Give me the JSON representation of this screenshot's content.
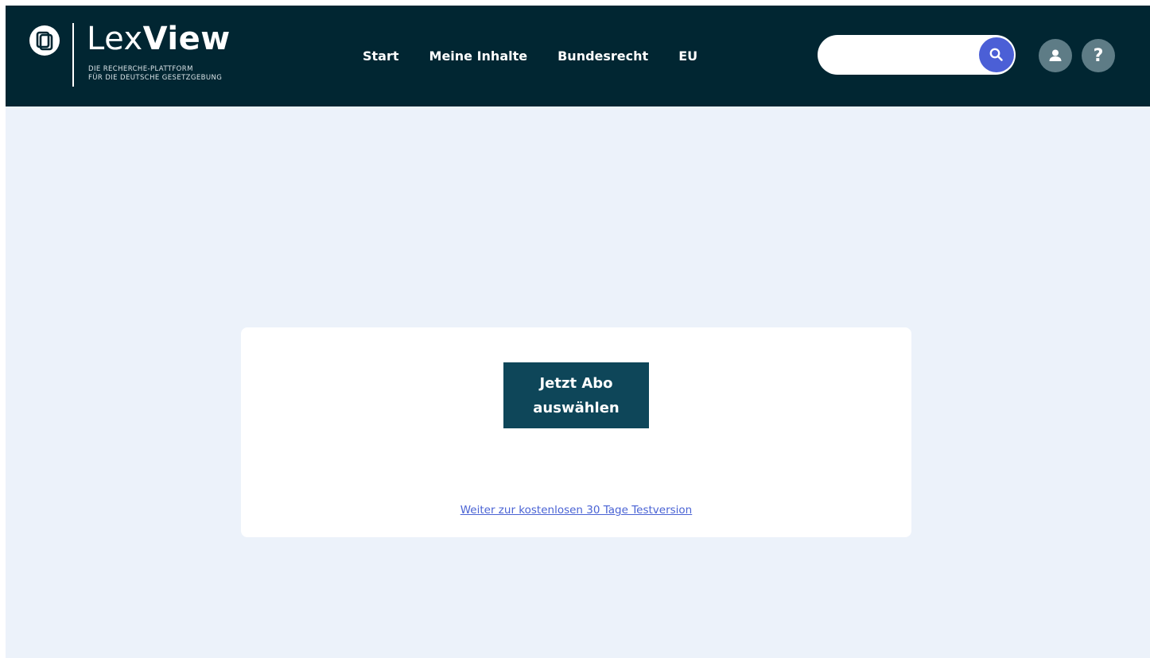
{
  "brand": {
    "name_light": "Lex",
    "name_bold": "View",
    "tagline_line1": "DIE RECHERCHE-PLATTFORM",
    "tagline_line2": "FÜR DIE DEUTSCHE GESETZGEBUNG"
  },
  "nav": {
    "items": [
      {
        "label": "Start"
      },
      {
        "label": "Meine Inhalte"
      },
      {
        "label": "Bundesrecht"
      },
      {
        "label": "EU"
      }
    ]
  },
  "search": {
    "value": "",
    "placeholder": ""
  },
  "header_buttons": {
    "help_glyph": "?"
  },
  "main": {
    "cta_label": "Jetzt Abo auswählen",
    "trial_link": "Weiter zur kostenlosen 30 Tage Testversion"
  },
  "colors": {
    "header_bg": "#012632",
    "page_bg": "#ecf2fa",
    "search_accent": "#4b5fd6",
    "cta_bg": "#0e4659",
    "link": "#4a63d4"
  }
}
